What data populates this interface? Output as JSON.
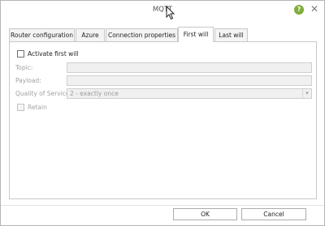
{
  "window": {
    "title": "MQTT",
    "help_glyph": "?",
    "close_glyph": "✕"
  },
  "icons": {
    "help": "help-circle-icon",
    "close": "close-icon",
    "cursor": "mouse-pointer-icon",
    "dropdown": "chevron-down-icon"
  },
  "colors": {
    "help_green": "#7fae3a",
    "disabled_field": "#f0f0f0",
    "border": "#c8c8c8"
  },
  "tabs": [
    {
      "label": "Router configuration",
      "active": false
    },
    {
      "label": "Azure",
      "active": false
    },
    {
      "label": "Connection properties",
      "active": false
    },
    {
      "label": "First will",
      "active": true
    },
    {
      "label": "Last will",
      "active": false
    }
  ],
  "form": {
    "activate_label": "Activate first will",
    "activate_checked": false,
    "topic_label": "Topic:",
    "topic_value": "",
    "payload_label": "Payload:",
    "payload_value": "",
    "qos_label": "Quality of Service:",
    "qos_value": "2 - exactly once",
    "retain_label": "Retain",
    "retain_checked": false
  },
  "buttons": {
    "ok": "OK",
    "cancel": "Cancel"
  }
}
